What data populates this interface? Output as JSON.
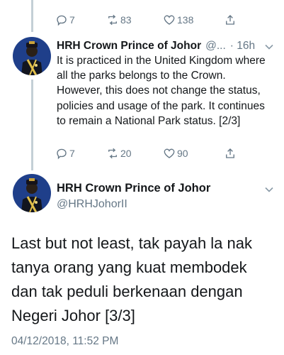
{
  "prev_tweet": {
    "actions": {
      "reply_count": "7",
      "retweet_count": "83",
      "like_count": "138"
    }
  },
  "reply_tweet": {
    "name": "HRH Crown Prince of Johor",
    "handle": "@...",
    "time": "· 16h",
    "text": "It is practiced in the United Kingdom where all the parks belongs to the Crown. However, this does not change the status, policies and usage of the park. It continues to remain a National Park status. [2/3]",
    "actions": {
      "reply_count": "7",
      "retweet_count": "20",
      "like_count": "90"
    }
  },
  "main_tweet": {
    "name": "HRH Crown Prince of Johor",
    "handle": "@HRHJohorII",
    "text": "Last but not least, tak payah la nak tanya orang yang kuat membodek dan tak peduli berkenaan dengan Negeri Johor [3/3]",
    "timestamp": "04/12/2018, 11:52 PM"
  },
  "icons": {
    "reply": "reply-icon",
    "retweet": "retweet-icon",
    "like": "heart-icon",
    "share": "share-icon",
    "caret": "chevron-down-icon"
  },
  "colors": {
    "text": "#14171a",
    "muted": "#657786",
    "thread_line": "#c4cfd6",
    "avatar_bg": "#1f3f8a"
  }
}
